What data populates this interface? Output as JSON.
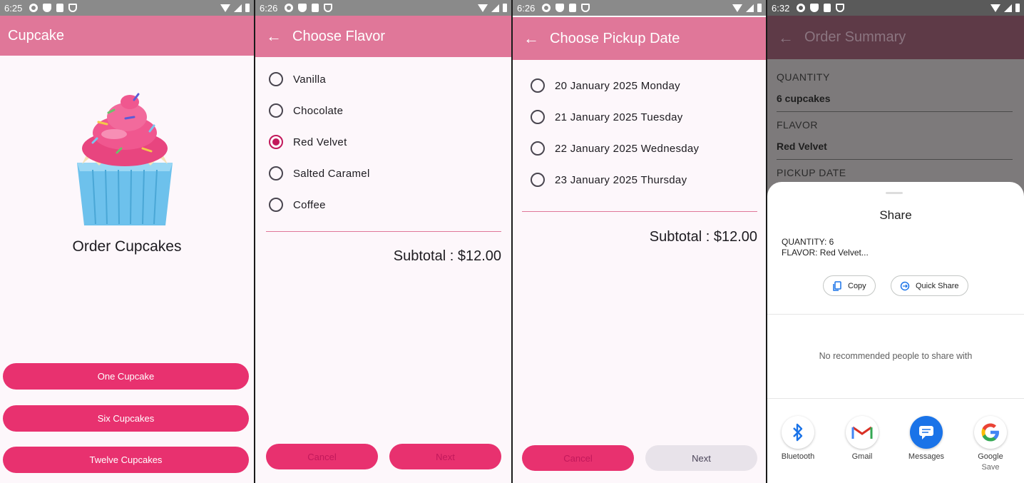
{
  "screens": [
    {
      "status_time": "6:25",
      "title": "Cupcake",
      "heading": "Order Cupcakes",
      "buttons": [
        "One Cupcake",
        "Six Cupcakes",
        "Twelve Cupcakes"
      ]
    },
    {
      "status_time": "6:26",
      "title": "Choose Flavor",
      "options": [
        "Vanilla",
        "Chocolate",
        "Red Velvet",
        "Salted Caramel",
        "Coffee"
      ],
      "selected": "Red Velvet",
      "subtotal": "Subtotal : $12.00",
      "cancel": "Cancel",
      "next": "Next"
    },
    {
      "status_time": "6:26",
      "title": "Choose Pickup Date",
      "options": [
        "20 January 2025 Monday",
        "21 January 2025 Tuesday",
        "22 January 2025 Wednesday",
        "23 January 2025 Thursday"
      ],
      "subtotal": "Subtotal : $12.00",
      "cancel": "Cancel",
      "next": "Next"
    },
    {
      "status_time": "6:32",
      "title": "Order Summary",
      "summary": [
        {
          "label": "QUANTITY",
          "value": "6 cupcakes"
        },
        {
          "label": "FLAVOR",
          "value": "Red Velvet"
        },
        {
          "label": "PICKUP DATE",
          "value": ""
        }
      ],
      "share": {
        "title": "Share",
        "preview_line1": "QUANTITY: 6",
        "preview_line2": "FLAVOR: Red Velvet...",
        "copy": "Copy",
        "quick_share": "Quick Share",
        "no_recommend": "No recommended people to share with",
        "apps": [
          "Bluetooth",
          "Gmail",
          "Messages",
          "Google"
        ],
        "apps_sub": "Save"
      }
    }
  ],
  "colors": {
    "app_bar": "#e07799",
    "button": "#e8316f",
    "accent": "#c2185b"
  }
}
